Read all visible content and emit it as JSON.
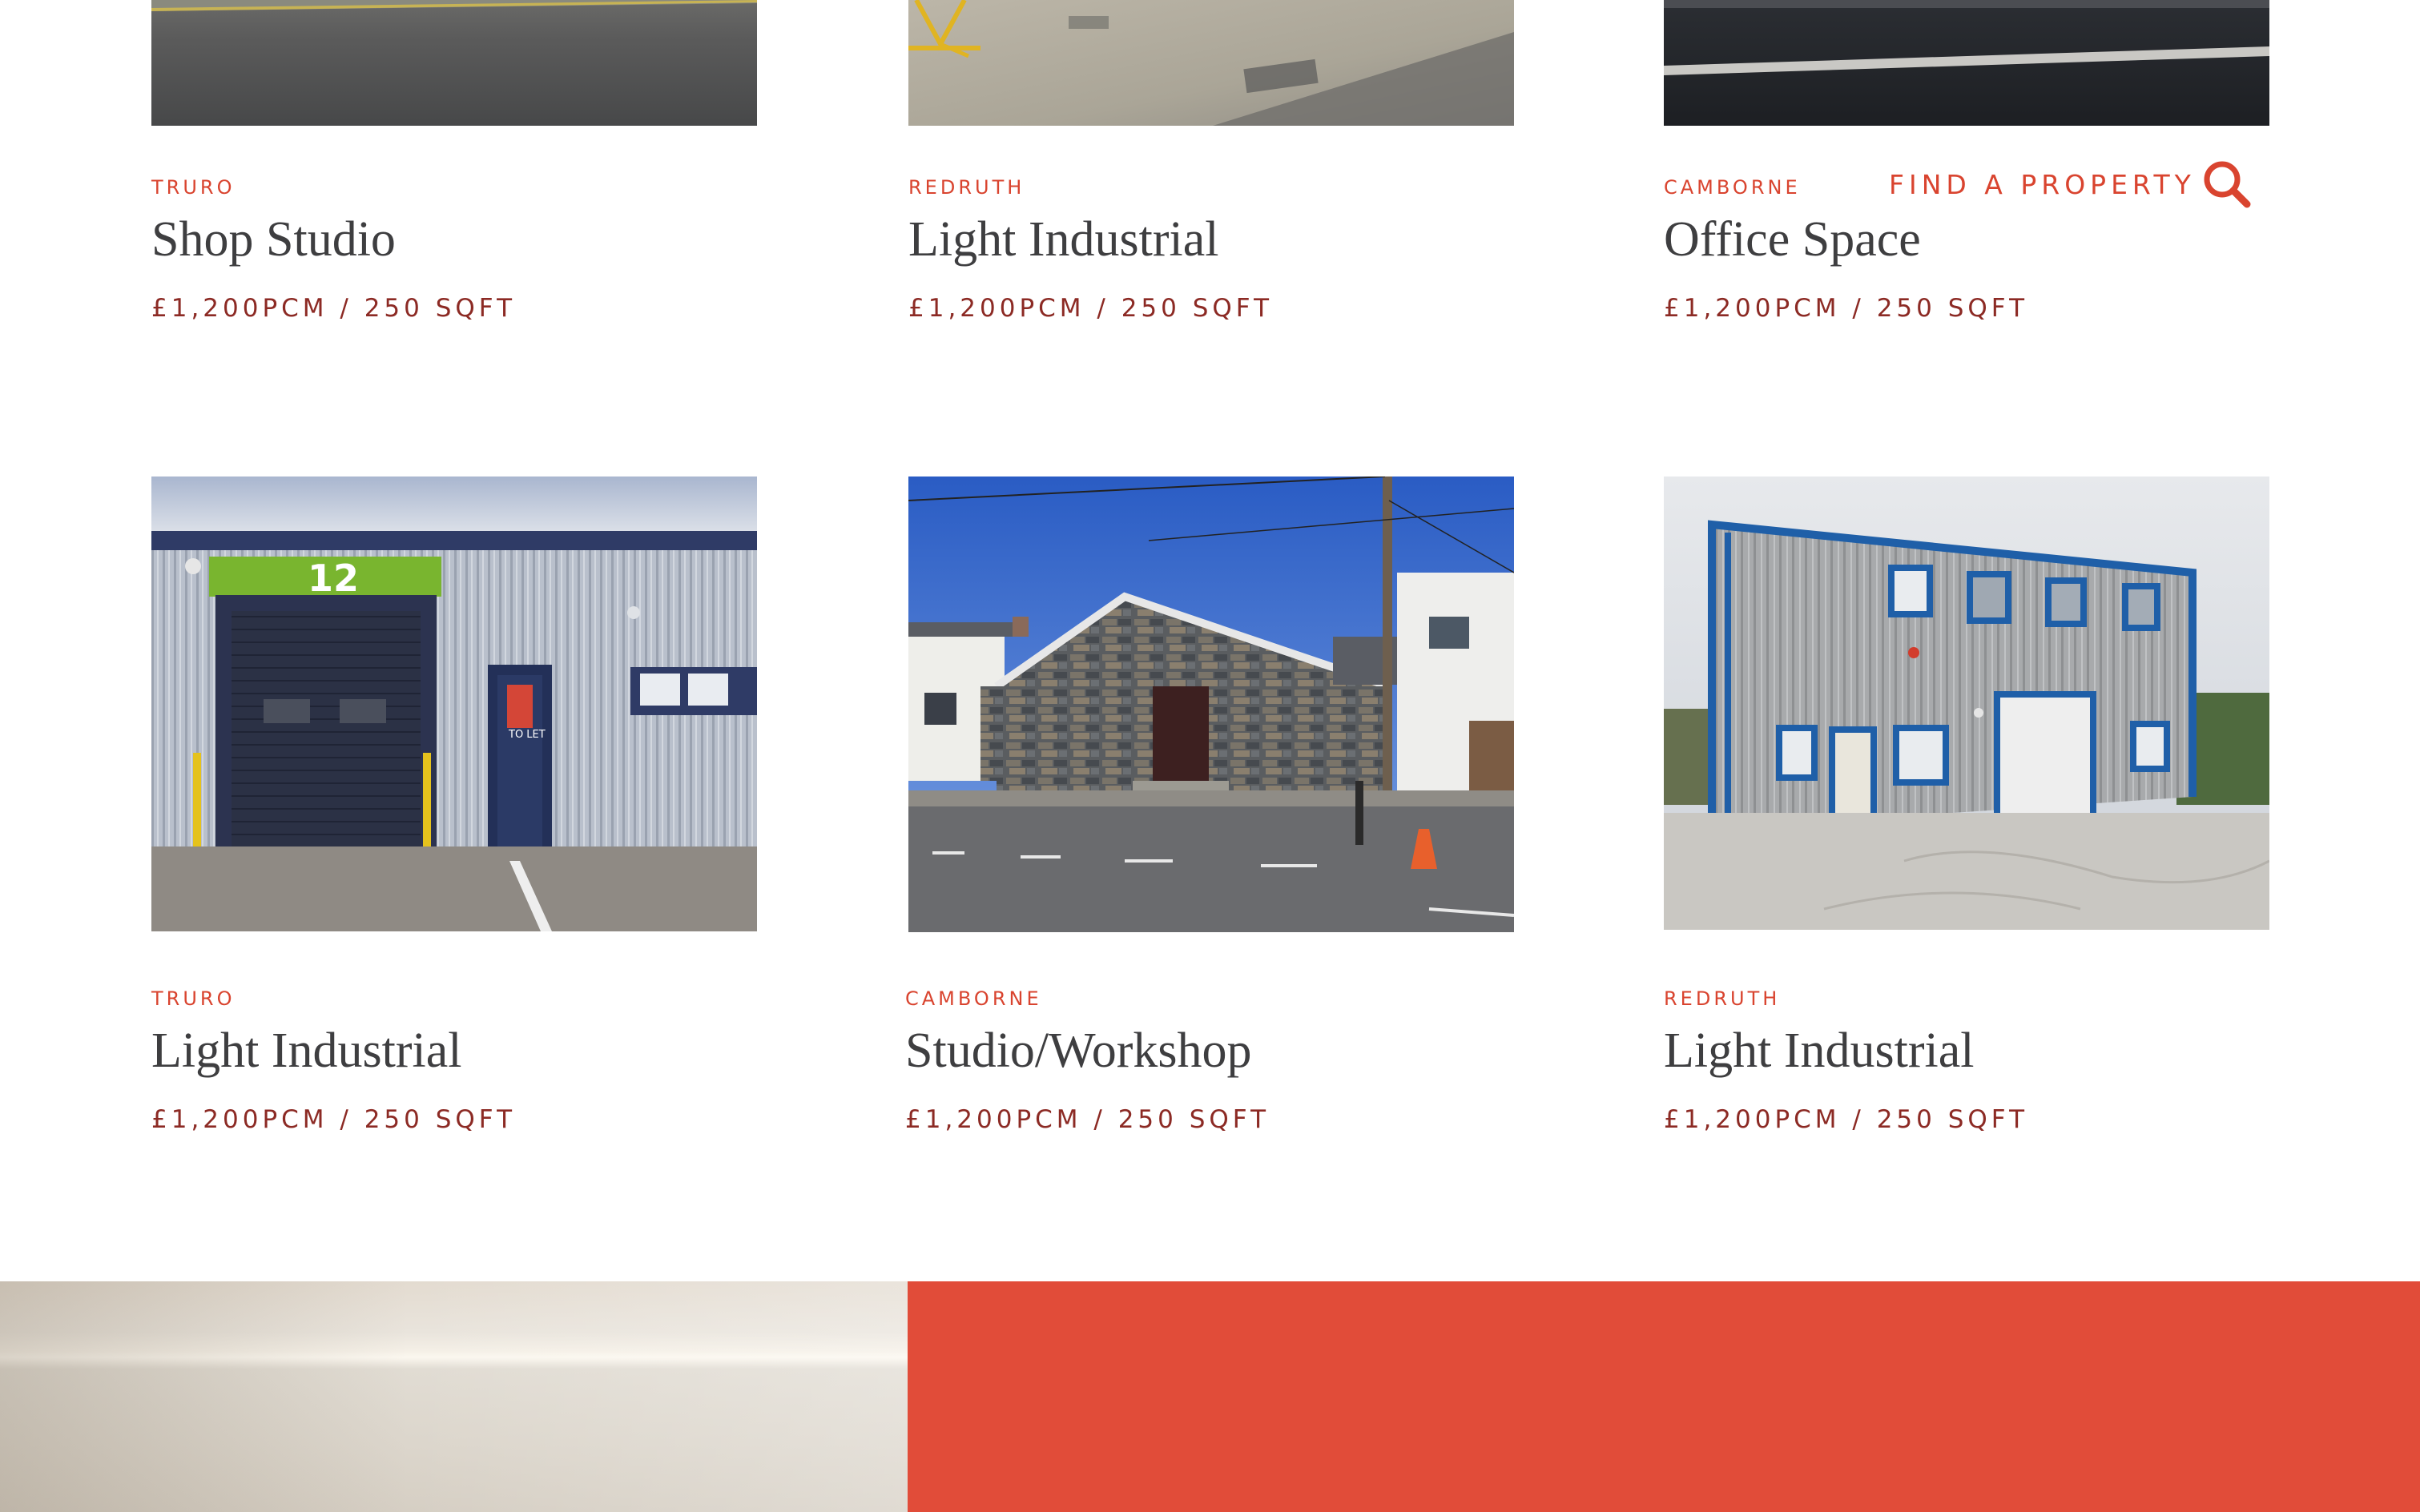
{
  "header": {
    "find_label": "FIND A PROPERTY",
    "search_icon": "search-icon"
  },
  "properties": [
    {
      "location": "TRURO",
      "title": "Shop Studio",
      "price": "£1,200PCM / 250 SQFT",
      "image": "street-tarmac-photo"
    },
    {
      "location": "REDRUTH",
      "title": "Light Industrial",
      "price": "£1,200PCM / 250 SQFT",
      "image": "concrete-yard-photo"
    },
    {
      "location": "CAMBORNE",
      "title": "Office Space",
      "price": "£1,200PCM / 250 SQFT",
      "image": "car-park-photo"
    },
    {
      "location": "TRURO",
      "title": "Light Industrial",
      "price": "£1,200PCM / 250 SQFT",
      "image": "industrial-unit-photo",
      "sign_text": "TO LET",
      "unit_number": "12"
    },
    {
      "location": "CAMBORNE",
      "title": "Studio/Workshop",
      "price": "£1,200PCM / 250 SQFT",
      "image": "stone-chapel-photo"
    },
    {
      "location": "REDRUTH",
      "title": "Light Industrial",
      "price": "£1,200PCM / 250 SQFT",
      "image": "two-storey-unit-photo"
    }
  ],
  "colors": {
    "accent": "#d9442f",
    "price": "#8c2a24",
    "title": "#3e3e40",
    "band_red": "#e14c39"
  }
}
